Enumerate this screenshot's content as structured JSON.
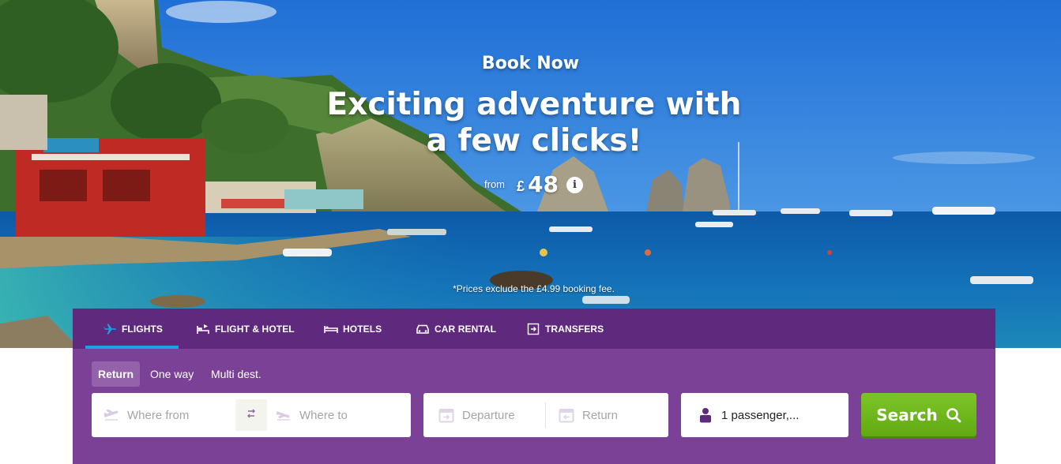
{
  "hero": {
    "eyebrow": "Book Now",
    "headline": "Exciting adventure with a few clicks!",
    "price_from_label": "from",
    "price_currency": "£",
    "price_value": "48",
    "info_icon": "info-icon",
    "fee_note": "*Prices exclude the £4.99 booking fee."
  },
  "tabs": [
    {
      "label": "FLIGHTS",
      "icon": "plane-icon",
      "active": true
    },
    {
      "label": "FLIGHT & HOTEL",
      "icon": "bed-plane-icon",
      "active": false
    },
    {
      "label": "HOTELS",
      "icon": "bed-icon",
      "active": false
    },
    {
      "label": "CAR RENTAL",
      "icon": "car-icon",
      "active": false
    },
    {
      "label": "TRANSFERS",
      "icon": "transfer-icon",
      "active": false
    }
  ],
  "trip_types": [
    {
      "label": "Return",
      "active": true
    },
    {
      "label": "One way",
      "active": false
    },
    {
      "label": "Multi dest.",
      "active": false
    }
  ],
  "search": {
    "from_placeholder": "Where from",
    "to_placeholder": "Where to",
    "departure_placeholder": "Departure",
    "return_placeholder": "Return",
    "passengers_value": "1 passenger,...",
    "search_label": "Search"
  },
  "colors": {
    "tab_bar": "#5f2a7e",
    "panel": "#7b4196",
    "active_underline": "#1ea2e6",
    "search_button": "#6db51b"
  }
}
